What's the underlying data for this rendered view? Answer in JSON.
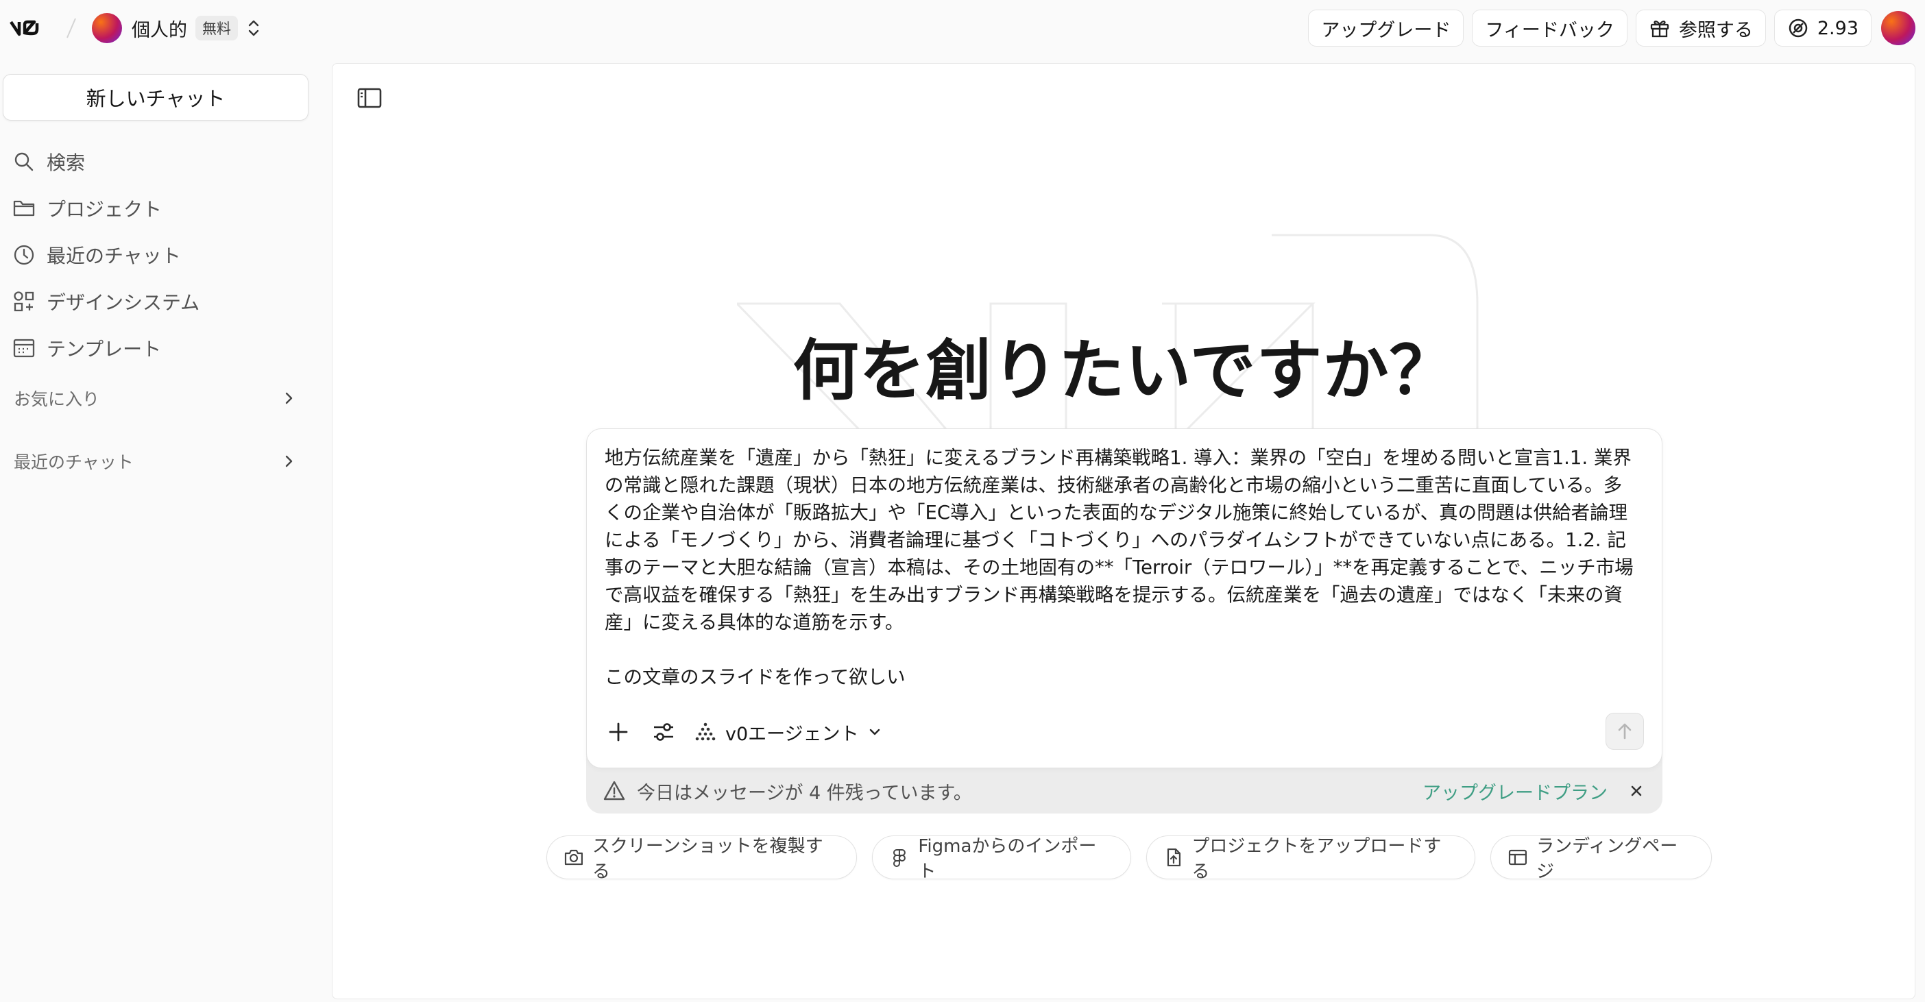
{
  "header": {
    "logo": "v0",
    "workspace": {
      "name": "個人的",
      "badge": "無料"
    },
    "buttons": {
      "upgrade": "アップグレード",
      "feedback": "フィードバック",
      "refer": "参照する"
    },
    "credits": "2.93",
    "icons": [
      "gift-icon",
      "credits-icon",
      "chevron-updown-icon"
    ]
  },
  "sidebar": {
    "new_chat": "新しいチャット",
    "items": [
      {
        "label": "検索",
        "icon": "search-icon"
      },
      {
        "label": "プロジェクト",
        "icon": "folder-icon"
      },
      {
        "label": "最近のチャット",
        "icon": "clock-icon"
      },
      {
        "label": "デザインシステム",
        "icon": "shapes-icon"
      },
      {
        "label": "テンプレート",
        "icon": "template-icon"
      }
    ],
    "sections": {
      "favorites": "お気に入り",
      "recent": "最近のチャット"
    }
  },
  "main": {
    "headline": "何を創りたいですか？",
    "prompt": "地方伝統産業を「遺産」から「熱狂」に変えるブランド再構築戦略1. 導入：業界の「空白」を埋める問いと宣言1.1. 業界の常識と隠れた課題（現状）日本の地方伝統産業は、技術継承者の高齢化と市場の縮小という二重苦に直面している。多くの企業や自治体が「販路拡大」や「EC導入」といった表面的なデジタル施策に終始しているが、真の問題は供給者論理による「モノづくり」から、消費者論理に基づく「コトづくり」へのパラダイムシフトができていない点にある。1.2. 記事のテーマと大胆な結論（宣言）本稿は、その土地固有の**「Terroir（テロワール）」**を再定義することで、ニッチ市場で高収益を確保する「熱狂」を生み出すブランド再構築戦略を提示する。伝統産業を「過去の遺産」ではなく「未来の資産」に変える具体的な道筋を示す。\n\nこの文章のスライドを作って欲しい",
    "agent": "v0エージェント",
    "limit": {
      "text": "今日はメッセージが 4 件残っています。",
      "upgrade": "アップグレードプラン"
    },
    "suggestions": [
      {
        "label": "スクリーンショットを複製する",
        "icon": "camera-icon"
      },
      {
        "label": "Figmaからのインポート",
        "icon": "figma-icon"
      },
      {
        "label": "プロジェクトをアップロードする",
        "icon": "file-upload-icon"
      },
      {
        "label": "ランディングページ",
        "icon": "layout-icon"
      }
    ]
  },
  "colors": {
    "accent_link": "#3f9e84",
    "text": "#171717",
    "muted": "#525252"
  }
}
